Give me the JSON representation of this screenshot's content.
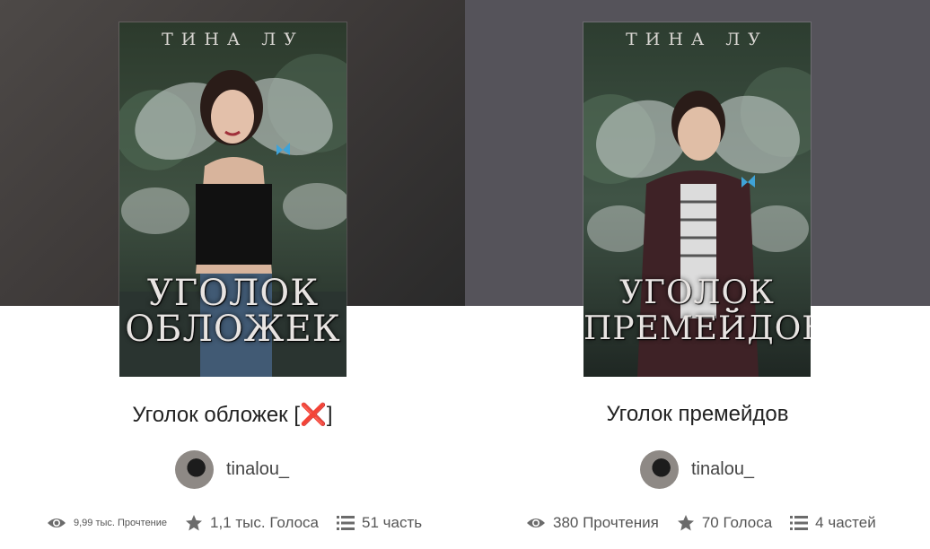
{
  "colors": {
    "accent_red": "#d9141f",
    "text_dark": "#222222",
    "text_muted": "#555555"
  },
  "stories": [
    {
      "cover": {
        "author": "ТИНА ЛУ",
        "title_line1": "УГОЛОК",
        "title_line2": "ОБЛОЖЕК"
      },
      "title": "Уголок обложек [",
      "title_mark": "❌",
      "title_end": "]",
      "author": "tinalou_",
      "reads": "9,99 тыс. Прочтение",
      "votes": "1,1 тыс. Голоса",
      "parts": "51 часть"
    },
    {
      "cover": {
        "author": "ТИНА ЛУ",
        "title_line1": "УГОЛОК",
        "title_line2": "ПРЕМЕЙДОВ"
      },
      "title": "Уголок премейдов",
      "author": "tinalou_",
      "reads": "380 Прочтения",
      "votes": "70 Голоса",
      "parts": "4 частей"
    }
  ]
}
